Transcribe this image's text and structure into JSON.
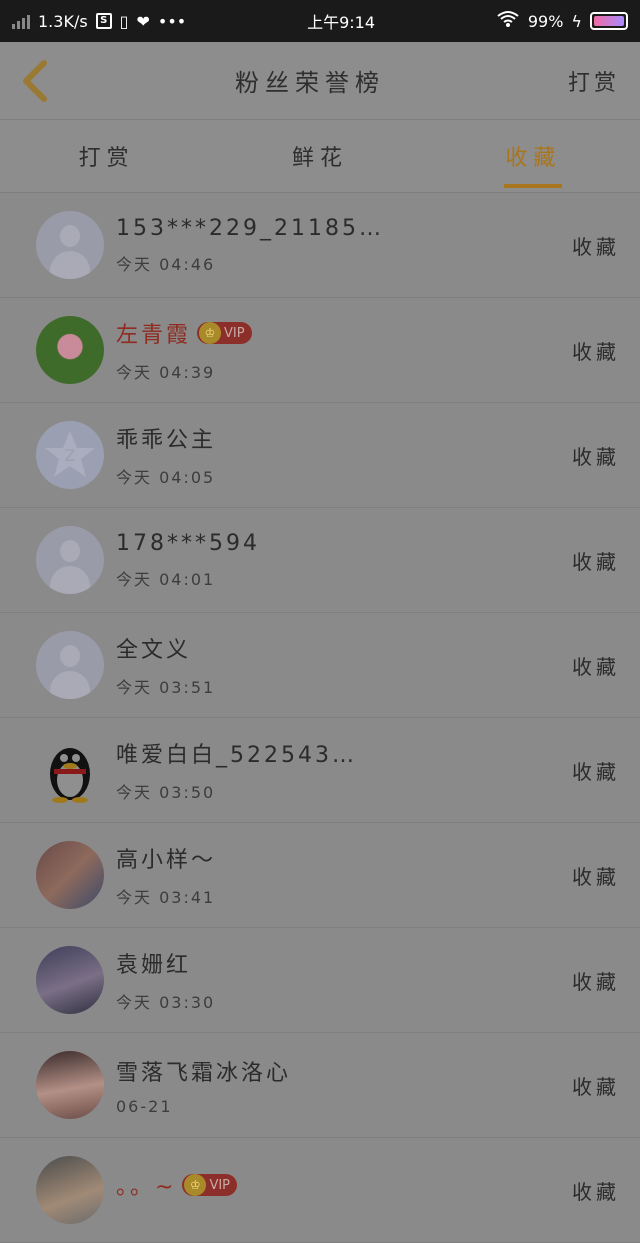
{
  "status_bar": {
    "speed": "1.3K/s",
    "time": "上午9:14",
    "battery": "99%"
  },
  "header": {
    "title": "粉丝荣誉榜",
    "right_action": "打赏"
  },
  "tabs": [
    {
      "label": "打赏",
      "active": false
    },
    {
      "label": "鲜花",
      "active": false
    },
    {
      "label": "收藏",
      "active": true
    }
  ],
  "accent_color": "#a9761f",
  "list": [
    {
      "name": "153***229_21185…",
      "time": "今天 04:46",
      "action": "收藏",
      "avatar": "default-avatar",
      "vip": false
    },
    {
      "name": "左青霞",
      "time": "今天 04:39",
      "action": "收藏",
      "avatar": "lotus-avatar",
      "vip": true,
      "vip_label": "VIP"
    },
    {
      "name": "乖乖公主",
      "time": "今天 04:05",
      "action": "收藏",
      "avatar": "star-avatar",
      "vip": false
    },
    {
      "name": "178***594",
      "time": "今天 04:01",
      "action": "收藏",
      "avatar": "default-avatar",
      "vip": false
    },
    {
      "name": "全文义",
      "time": "今天 03:51",
      "action": "收藏",
      "avatar": "default-avatar",
      "vip": false
    },
    {
      "name": "唯爱白白_522543…",
      "time": "今天 03:50",
      "action": "收藏",
      "avatar": "penguin-avatar",
      "vip": false
    },
    {
      "name": "高小样～",
      "time": "今天 03:41",
      "action": "收藏",
      "avatar": "photo-avatar",
      "vip": false
    },
    {
      "name": "袁姗红",
      "time": "今天 03:30",
      "action": "收藏",
      "avatar": "photo-avatar",
      "vip": false
    },
    {
      "name": "雪落飞霜冰洛心",
      "time": "06-21",
      "action": "收藏",
      "avatar": "photo-avatar",
      "vip": false
    },
    {
      "name": "。。~",
      "time": "",
      "action": "收藏",
      "avatar": "photo-avatar",
      "vip": true,
      "vip_label": "VIP"
    }
  ]
}
